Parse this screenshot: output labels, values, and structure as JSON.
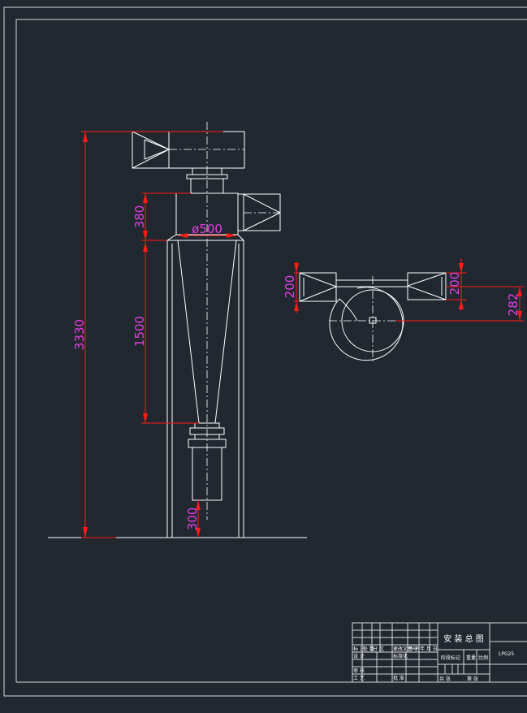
{
  "dimensions": {
    "total_height": "3330",
    "top_section": "380",
    "diameter": "ø500",
    "cone_length": "1500",
    "bottom": "300",
    "inlet_left": "200",
    "inlet_right": "200",
    "offset": "282"
  },
  "title_block": {
    "title": "安 装 总 图",
    "model": "LPG25",
    "row_labels": [
      "标 记",
      "处 数",
      "分 区",
      "更改文件号",
      "签 名",
      "年 月 日"
    ],
    "design": "设 计",
    "standard": "标准化",
    "review": "审 核",
    "process": "工 艺",
    "approve": "批 准",
    "stage_mark": "阶段标记",
    "weight": "重量",
    "scale": "比例",
    "total_sheets": "共 张",
    "sheet_no": "第 张"
  },
  "colors": {
    "background": "#212830",
    "lines": "#ffffff",
    "dimension_lines": "#ff1a1a",
    "dimension_text": "#e040e0"
  }
}
